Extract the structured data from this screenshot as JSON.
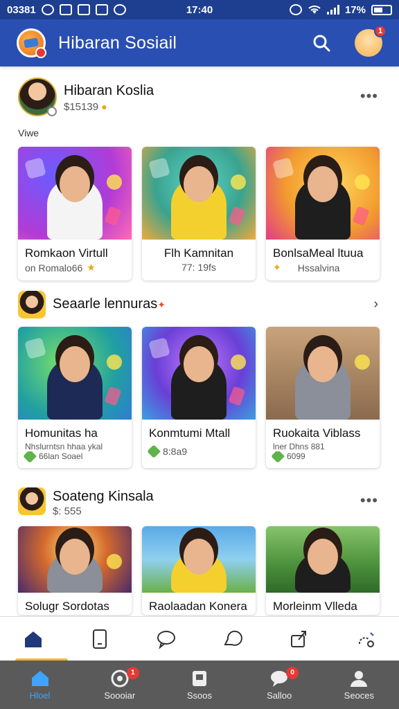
{
  "status_bar": {
    "left_text": "03381",
    "time": "17:40",
    "battery_percent": "17%"
  },
  "app_bar": {
    "title": "Hibaran Sosiail",
    "notification_count": "1"
  },
  "sections": [
    {
      "title": "Hibaran Koslia",
      "subtitle": "$15139",
      "caption": "Viwe",
      "cards": [
        {
          "title": "Romkaon Virtull",
          "meta": "on Romalo66"
        },
        {
          "title": "Flh Kamnitan",
          "meta": "77: 19fs"
        },
        {
          "title": "BonlsaMeal ltuua",
          "meta": "Hssalvina"
        }
      ]
    },
    {
      "title": "Seaarle lennuras",
      "cards": [
        {
          "title": "Homunitas ha",
          "meta": "Nhslurntsn hhaa ykal",
          "meta2": "66lan Soael"
        },
        {
          "title": "Konmtumi Mtall",
          "meta": "8:8a9"
        },
        {
          "title": "Ruokaita Viblass",
          "meta": "lner Dhns 881",
          "meta2": "6099"
        }
      ]
    },
    {
      "title": "Soateng Kinsala",
      "subtitle": "$: 555",
      "cards": [
        {
          "title": "Solugr Sordotas"
        },
        {
          "title": "Raolaadan Konera"
        },
        {
          "title": "Morleinm Vlleda"
        }
      ]
    }
  ],
  "tab_bar": {
    "items": [
      {
        "label": "Hloel"
      },
      {
        "label": "Soooiar",
        "badge": "1"
      },
      {
        "label": "Ssoos"
      },
      {
        "label": "Salloo",
        "badge": "0"
      },
      {
        "label": "Seoces"
      }
    ]
  },
  "colors": {
    "primary": "#2a4fb2",
    "status_bar": "#1e3f8f",
    "active_indicator": "#f2b43b",
    "tab_bar": "#5a5a5a",
    "tab_active": "#3ea4ff"
  }
}
